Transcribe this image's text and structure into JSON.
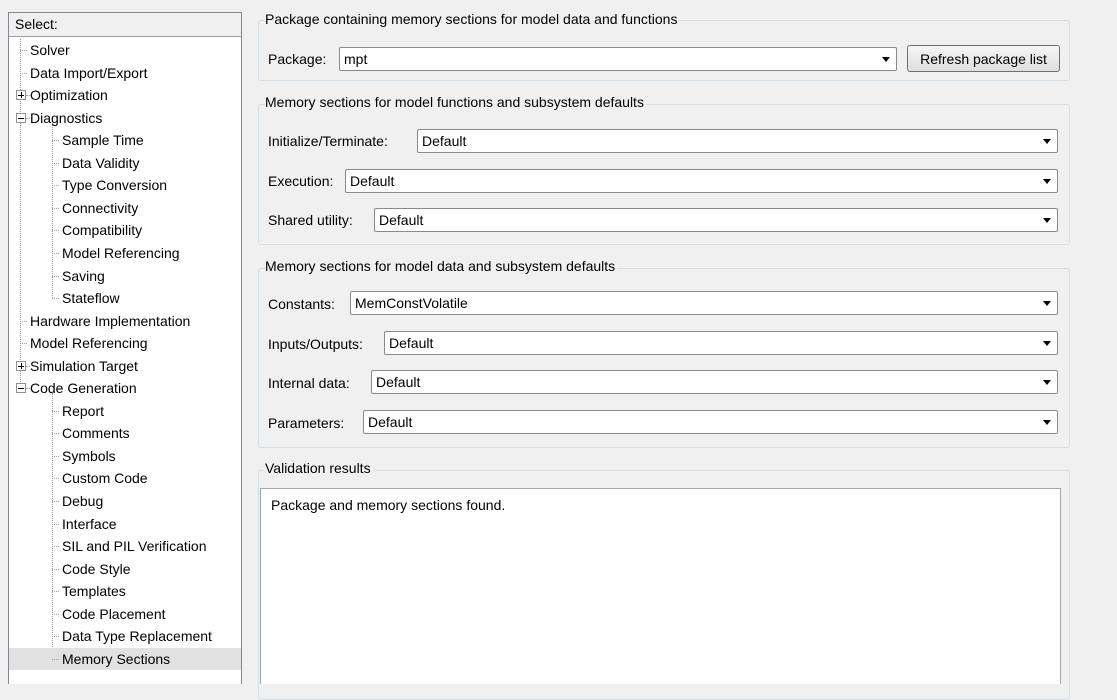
{
  "tree": {
    "header": "Select:",
    "items": [
      {
        "label": "Solver"
      },
      {
        "label": "Data Import/Export"
      },
      {
        "label": "Optimization"
      },
      {
        "label": "Diagnostics"
      },
      {
        "label": "Sample Time"
      },
      {
        "label": "Data Validity"
      },
      {
        "label": "Type Conversion"
      },
      {
        "label": "Connectivity"
      },
      {
        "label": "Compatibility"
      },
      {
        "label": "Model Referencing"
      },
      {
        "label": "Saving"
      },
      {
        "label": "Stateflow"
      },
      {
        "label": "Hardware Implementation"
      },
      {
        "label": "Model Referencing"
      },
      {
        "label": "Simulation Target"
      },
      {
        "label": "Code Generation"
      },
      {
        "label": "Report"
      },
      {
        "label": "Comments"
      },
      {
        "label": "Symbols"
      },
      {
        "label": "Custom Code"
      },
      {
        "label": "Debug"
      },
      {
        "label": "Interface"
      },
      {
        "label": "SIL and PIL Verification"
      },
      {
        "label": "Code Style"
      },
      {
        "label": "Templates"
      },
      {
        "label": "Code Placement"
      },
      {
        "label": "Data Type Replacement"
      },
      {
        "label": "Memory Sections"
      }
    ]
  },
  "package_group": {
    "title": "Package containing memory sections for model data and functions",
    "package_label": "Package:",
    "package_value": "mpt",
    "refresh_label": "Refresh package list"
  },
  "functions_group": {
    "title": "Memory sections for model functions and subsystem defaults",
    "init_label": "Initialize/Terminate:",
    "init_value": "Default",
    "exec_label": "Execution:",
    "exec_value": "Default",
    "shared_label": "Shared utility:",
    "shared_value": "Default"
  },
  "data_group": {
    "title": "Memory sections for model data and subsystem defaults",
    "constants_label": "Constants:",
    "constants_value": "MemConstVolatile",
    "io_label": "Inputs/Outputs:",
    "io_value": "Default",
    "internal_label": "Internal data:",
    "internal_value": "Default",
    "params_label": "Parameters:",
    "params_value": "Default"
  },
  "validation_group": {
    "title": "Validation results",
    "message": "Package and memory sections found."
  }
}
